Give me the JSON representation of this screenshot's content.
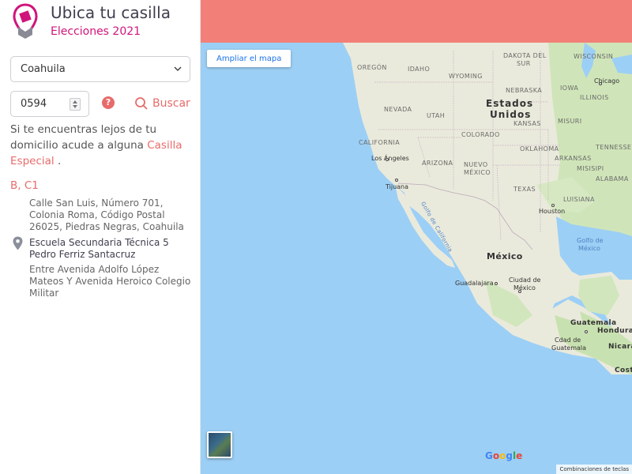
{
  "header": {
    "title": "Ubica tu casilla",
    "subtitle": "Elecciones 2021",
    "logo_icon": "ballot-pin-logo",
    "accent_color": "#d0147b"
  },
  "search": {
    "state_value": "Coahuila",
    "section_value": "0594",
    "help_icon": "question-icon",
    "search_label": "Buscar",
    "far_text": "Si te encuentras lejos de tu domicilio acude a alguna",
    "far_link": "Casilla Especial",
    "far_end": "."
  },
  "result": {
    "code": "B, C1",
    "address": "Calle San Luis, Número 701, Colonia Roma, Código Postal 26025, Piedras Negras, Coahuila",
    "school": "Escuela Secundaria Técnica 5 Pedro Ferriz Santacruz",
    "between": "Entre Avenida Adolfo López Mateos Y Avenida Heroico Colegio Militar"
  },
  "map": {
    "header_color": "#f38078",
    "enlarge_label": "Ampliar el mapa",
    "keyboard_label": "Combinaciones de teclas",
    "google_letters": [
      "G",
      "o",
      "o",
      "g",
      "l",
      "e"
    ],
    "labels": {
      "oregon": "OREGÓN",
      "idaho": "IDAHO",
      "wyoming": "WYOMING",
      "dakota_sur": "DAKOTA DEL",
      "dakota_sur2": "SUR",
      "wisconsin": "WISCONSIN",
      "chicago": "Chicago",
      "nebraska": "NEBRASKA",
      "iowa": "IOWA",
      "illinois": "ILLINOIS",
      "nevada": "NEVADA",
      "utah": "UTAH",
      "estados": "Estados",
      "unidos": "Unidos",
      "kansas": "KANSAS",
      "missouri": "MISURI",
      "california": "CALIFORNIA",
      "colorado": "COLORADO",
      "tennessee": "TENNESSEE",
      "los_angeles": "Los Ángeles",
      "arizona": "ARIZONA",
      "oklahoma": "OKLAHOMA",
      "arkansas": "ARKANSAS",
      "tijuana": "Tijuana",
      "nuevo": "NUEVO",
      "mexico_state": "MÉXICO",
      "mississippi": "MISISIPI",
      "alabama": "ALABAMA",
      "texas": "TEXAS",
      "luisiana": "LUISIANA",
      "houston": "Houston",
      "gulf_ca": "Golfo de California",
      "gulf_mx": "Golfo de",
      "gulf_mx2": "México",
      "mexico": "México",
      "guadalajara": "Guadalajara",
      "cdmx": "Ciudad de",
      "cdmx2": "México",
      "guatemala": "Guatemala",
      "honduras": "Honduras",
      "cd_guatemala": "Cdad de",
      "cd_guatemala2": "Guatemala",
      "nicaragua": "Nicarag",
      "costa": "Costa"
    }
  }
}
